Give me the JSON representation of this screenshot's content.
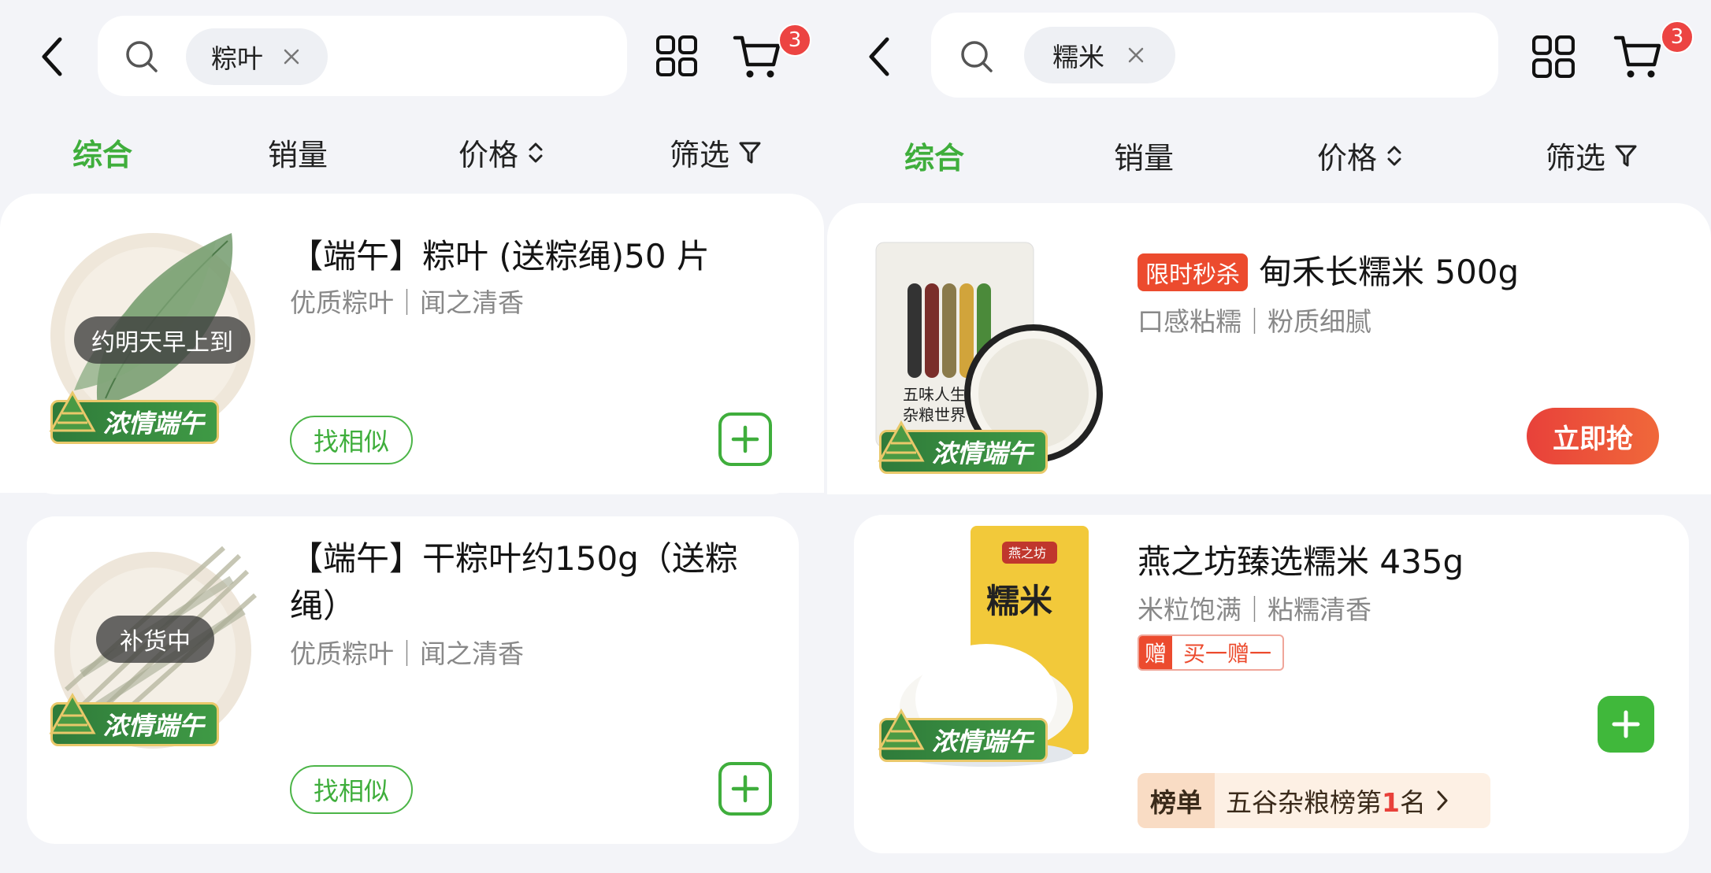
{
  "left": {
    "search": {
      "keyword": "粽叶"
    },
    "cart": {
      "badge": "3"
    },
    "tabs": [
      {
        "label": "综合",
        "active": true
      },
      {
        "label": "销量"
      },
      {
        "label": "价格"
      },
      {
        "label": "筛选"
      }
    ],
    "products": [
      {
        "title": "【端午】粽叶 (送粽绳)50 片",
        "subtitle": "优质粽叶｜闻之清香",
        "status": "约明天早上到",
        "festival_badge": "浓情端午",
        "similar_label": "找相似"
      },
      {
        "title_line1": "【端午】干粽叶约150g（送粽",
        "title_line2": "绳）",
        "subtitle": "优质粽叶｜闻之清香",
        "status": "补货中",
        "festival_badge": "浓情端午",
        "similar_label": "找相似"
      }
    ]
  },
  "right": {
    "search": {
      "keyword": "糯米"
    },
    "cart": {
      "badge": "3"
    },
    "tabs": [
      {
        "label": "综合",
        "active": true
      },
      {
        "label": "销量"
      },
      {
        "label": "价格"
      },
      {
        "label": "筛选"
      }
    ],
    "products": [
      {
        "promo_tag": "限时秒杀",
        "title": "甸禾长糯米 500g",
        "subtitle": "口感粘糯｜粉质细腻",
        "festival_badge": "浓情端午",
        "buy_label": "立即抢",
        "package_text_1": "五味人生",
        "package_text_2": "杂粮世界"
      },
      {
        "title": "燕之坊臻选糯米 435g",
        "subtitle": "米粒饱满｜粘糯清香",
        "gift_tag": "赠",
        "gift_text": "买一赠一",
        "festival_badge": "浓情端午",
        "package_brand": "燕之坊",
        "package_text": "糯米",
        "rank_label": "榜单",
        "rank_text_prefix": "五谷杂粮榜第",
        "rank_number": "1",
        "rank_text_suffix": "名"
      }
    ]
  },
  "colors": {
    "accent_green": "#3fae3c",
    "badge_red": "#ec4442",
    "promo_red": "#ec4b2e",
    "background": "#f3f4f8"
  },
  "icons": [
    "chevron-left-icon",
    "search-icon",
    "close-icon",
    "grid-icon",
    "cart-icon",
    "sort-chevrons-icon",
    "filter-funnel-icon",
    "plus-icon",
    "chevron-right-icon"
  ]
}
